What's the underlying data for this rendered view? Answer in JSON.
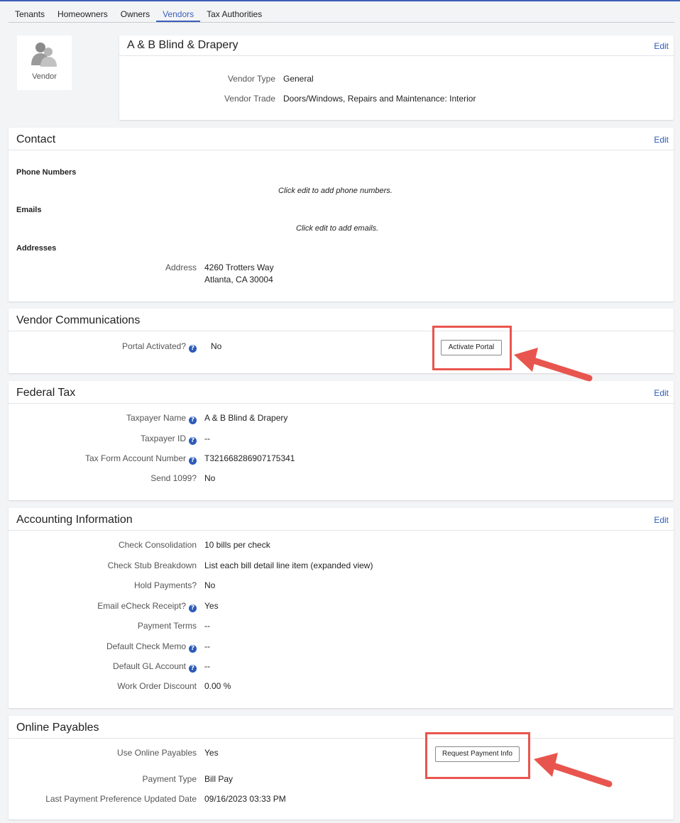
{
  "tabs": [
    "Tenants",
    "Homeowners",
    "Owners",
    "Vendors",
    "Tax Authorities"
  ],
  "active_tab": "Vendors",
  "avatar": {
    "label": "Vendor",
    "icon": "vendor-people-icon"
  },
  "vendor": {
    "name": "A & B Blind & Drapery",
    "edit_label": "Edit",
    "fields": [
      {
        "label": "Vendor Type",
        "value": "General"
      },
      {
        "label": "Vendor Trade",
        "value": "Doors/Windows, Repairs and Maintenance: Interior"
      }
    ]
  },
  "contact": {
    "title": "Contact",
    "edit_label": "Edit",
    "phone_heading": "Phone Numbers",
    "phone_hint": "Click edit to add phone numbers.",
    "email_heading": "Emails",
    "email_hint": "Click edit to add emails.",
    "address_heading": "Addresses",
    "address_label": "Address",
    "address_line1": "4260 Trotters Way",
    "address_line2": "Atlanta, CA 30004"
  },
  "communications": {
    "title": "Vendor Communications",
    "portal_label": "Portal Activated?",
    "portal_value": "No",
    "activate_button": "Activate Portal"
  },
  "federal_tax": {
    "title": "Federal Tax",
    "edit_label": "Edit",
    "fields": [
      {
        "label": "Taxpayer Name",
        "value": "A & B Blind & Drapery",
        "help": true
      },
      {
        "label": "Taxpayer ID",
        "value": "--",
        "help": true
      },
      {
        "label": "Tax Form Account Number",
        "value": "T321668286907175341",
        "help": true
      },
      {
        "label": "Send 1099?",
        "value": "No",
        "help": false
      }
    ]
  },
  "accounting": {
    "title": "Accounting Information",
    "edit_label": "Edit",
    "fields": [
      {
        "label": "Check Consolidation",
        "value": "10 bills per check",
        "help": false
      },
      {
        "label": "Check Stub Breakdown",
        "value": "List each bill detail line item (expanded view)",
        "help": false
      },
      {
        "label": "Hold Payments?",
        "value": "No",
        "help": false
      },
      {
        "label": "Email eCheck Receipt?",
        "value": "Yes",
        "help": true
      },
      {
        "label": "Payment Terms",
        "value": "--",
        "help": false
      },
      {
        "label": "Default Check Memo",
        "value": "--",
        "help": true
      },
      {
        "label": "Default GL Account",
        "value": "--",
        "help": true
      },
      {
        "label": "Work Order Discount",
        "value": "0.00 %",
        "help": false
      }
    ]
  },
  "payables": {
    "title": "Online Payables",
    "request_button": "Request Payment Info",
    "fields": [
      {
        "label": "Use Online Payables",
        "value": "Yes"
      },
      {
        "label": "Payment Type",
        "value": "Bill Pay"
      },
      {
        "label": "Last Payment Preference Updated Date",
        "value": "09/16/2023 03:33 PM"
      }
    ]
  },
  "colors": {
    "accent": "#3d5fb8",
    "link": "#2d5bb9",
    "annotation": "#e8554e"
  }
}
